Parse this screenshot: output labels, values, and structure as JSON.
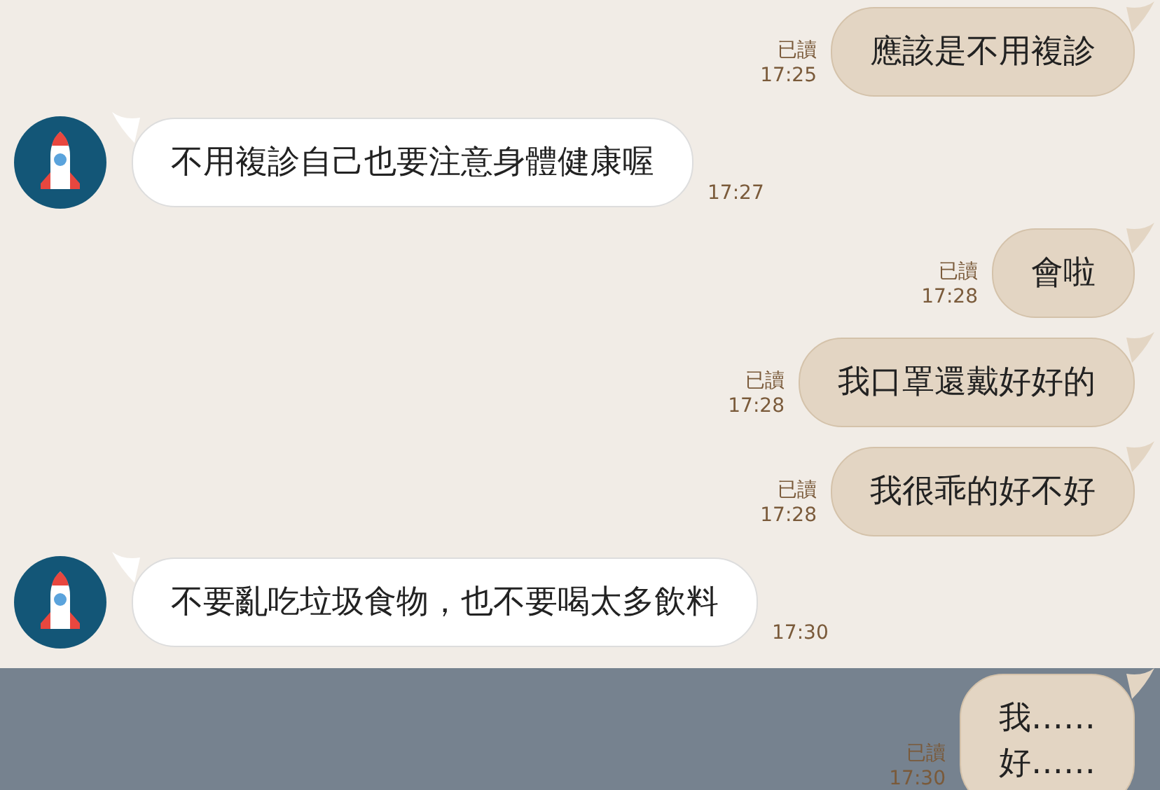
{
  "messages": [
    {
      "kind": "outgoing",
      "text": "應該是不用複診",
      "read_label": "已讀",
      "time": "17:25",
      "highlighted": false
    },
    {
      "kind": "incoming",
      "text": "不用複診自己也要注意身體健康喔",
      "time": "17:27",
      "highlighted": false
    },
    {
      "kind": "outgoing",
      "text": "會啦",
      "read_label": "已讀",
      "time": "17:28",
      "highlighted": false
    },
    {
      "kind": "outgoing",
      "text": "我口罩還戴好好的",
      "read_label": "已讀",
      "time": "17:28",
      "highlighted": false
    },
    {
      "kind": "outgoing",
      "text": "我很乖的好不好",
      "read_label": "已讀",
      "time": "17:28",
      "highlighted": false
    },
    {
      "kind": "incoming",
      "text": "不要亂吃垃圾食物，也不要喝太多飲料",
      "time": "17:30",
      "highlighted": false
    },
    {
      "kind": "outgoing",
      "text": "我……\n好……",
      "read_label": "已讀",
      "time": "17:30",
      "highlighted": true
    }
  ]
}
